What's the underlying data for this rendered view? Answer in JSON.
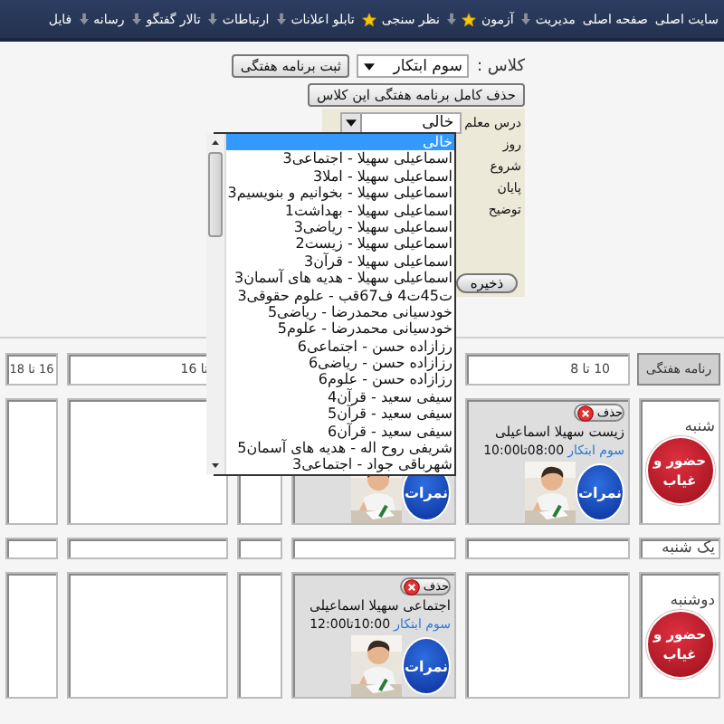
{
  "nav": [
    {
      "label": "سایت اصلی",
      "star": false,
      "dropdown": false
    },
    {
      "label": "صفحه اصلی",
      "star": false,
      "dropdown": false
    },
    {
      "label": "مدیریت",
      "star": false,
      "dropdown": true
    },
    {
      "label": "آزمون",
      "star": true,
      "dropdown": true
    },
    {
      "label": "نظر سنجی",
      "star": true,
      "dropdown": false
    },
    {
      "label": "تابلو اعلانات",
      "star": false,
      "dropdown": true
    },
    {
      "label": "ارتباطات",
      "star": false,
      "dropdown": true
    },
    {
      "label": "تالار گفتگو",
      "star": false,
      "dropdown": true
    },
    {
      "label": "رسانه",
      "star": false,
      "dropdown": true
    },
    {
      "label": "فایل",
      "star": false,
      "dropdown": false
    }
  ],
  "toolbar": {
    "class_label": "کلاس :",
    "class_value": "سوم ابتکار",
    "save_button": "ثبت برنامه هفتگی",
    "delete_button": "حذف کامل برنامه هفتگی این کلاس"
  },
  "form": {
    "fields": [
      {
        "label": "درس معلم",
        "kind": "select",
        "value": "خالی"
      },
      {
        "label": "روز",
        "kind": "label"
      },
      {
        "label": "شروع",
        "kind": "label"
      },
      {
        "label": "پایان",
        "kind": "label"
      },
      {
        "label": "توضیح",
        "kind": "label"
      }
    ],
    "save_button": "ذخیره"
  },
  "dropdown": {
    "items": [
      {
        "label": "خالی",
        "selected": true
      },
      {
        "label": "اسماعیلی سهیلا - اجتماعی3",
        "selected": false
      },
      {
        "label": "اسماعیلی سهیلا - املا3",
        "selected": false
      },
      {
        "label": "اسماعیلی سهیلا - بخوانیم و بنویسیم3",
        "selected": false
      },
      {
        "label": "اسماعیلی سهیلا - بهداشت1",
        "selected": false
      },
      {
        "label": "اسماعیلی سهیلا - ریاضی3",
        "selected": false
      },
      {
        "label": "اسماعیلی سهیلا - زیست2",
        "selected": false
      },
      {
        "label": "اسماعیلی سهیلا - قرآن3",
        "selected": false
      },
      {
        "label": "اسماعیلی سهیلا - هدیه های آسمان3",
        "selected": false
      },
      {
        "label": "ت45ت4 ف67قب - علوم حقوقی3",
        "selected": false
      },
      {
        "label": "خودسیانی محمدرضا - ریاضی5",
        "selected": false
      },
      {
        "label": "خودسیانی محمدرضا - علوم5",
        "selected": false
      },
      {
        "label": "رزازاده حسن - اجتماعی6",
        "selected": false
      },
      {
        "label": "رزازاده حسن - ریاضی6",
        "selected": false
      },
      {
        "label": "رزازاده حسن - علوم6",
        "selected": false
      },
      {
        "label": "سیفی سعید - قرآن4",
        "selected": false
      },
      {
        "label": "سیفی سعید - قرآن5",
        "selected": false
      },
      {
        "label": "سیفی سعید - قرآن6",
        "selected": false
      },
      {
        "label": "شریفی روح اله - هدیه های آسمان5",
        "selected": false
      },
      {
        "label": "شهرباقی جواد - اجتماعی3",
        "selected": false
      }
    ]
  },
  "schedule": {
    "corner": "رنامه هفتگی",
    "columns": [
      {
        "label": "10 تا 8"
      },
      {},
      {},
      {
        "label": "تا 16"
      },
      {
        "label": "16 تا 18"
      }
    ],
    "rows": [
      {
        "day": "شنبه",
        "attendance": "حضور و غیاب",
        "cells": [
          {
            "delete": "حذف",
            "title": "زیست سهیلا اسماعیلی",
            "class_link": "سوم ابتکار",
            "time": "08:00تا10:00",
            "grades": "نمرات"
          },
          {
            "grades": "نمرات"
          },
          null,
          null,
          null
        ]
      },
      {
        "day": "یک شنبه",
        "cells": [
          null,
          null,
          null,
          null,
          null
        ]
      },
      {
        "day": "دوشنبه",
        "attendance": "حضور و غیاب",
        "cells": [
          null,
          {
            "delete": "حذف",
            "title": "اجتماعی سهیلا اسماعیلی",
            "class_link": "سوم ابتکار",
            "time": "10:00تا12:00",
            "grades": "نمرات"
          },
          null,
          null,
          null
        ]
      }
    ]
  }
}
